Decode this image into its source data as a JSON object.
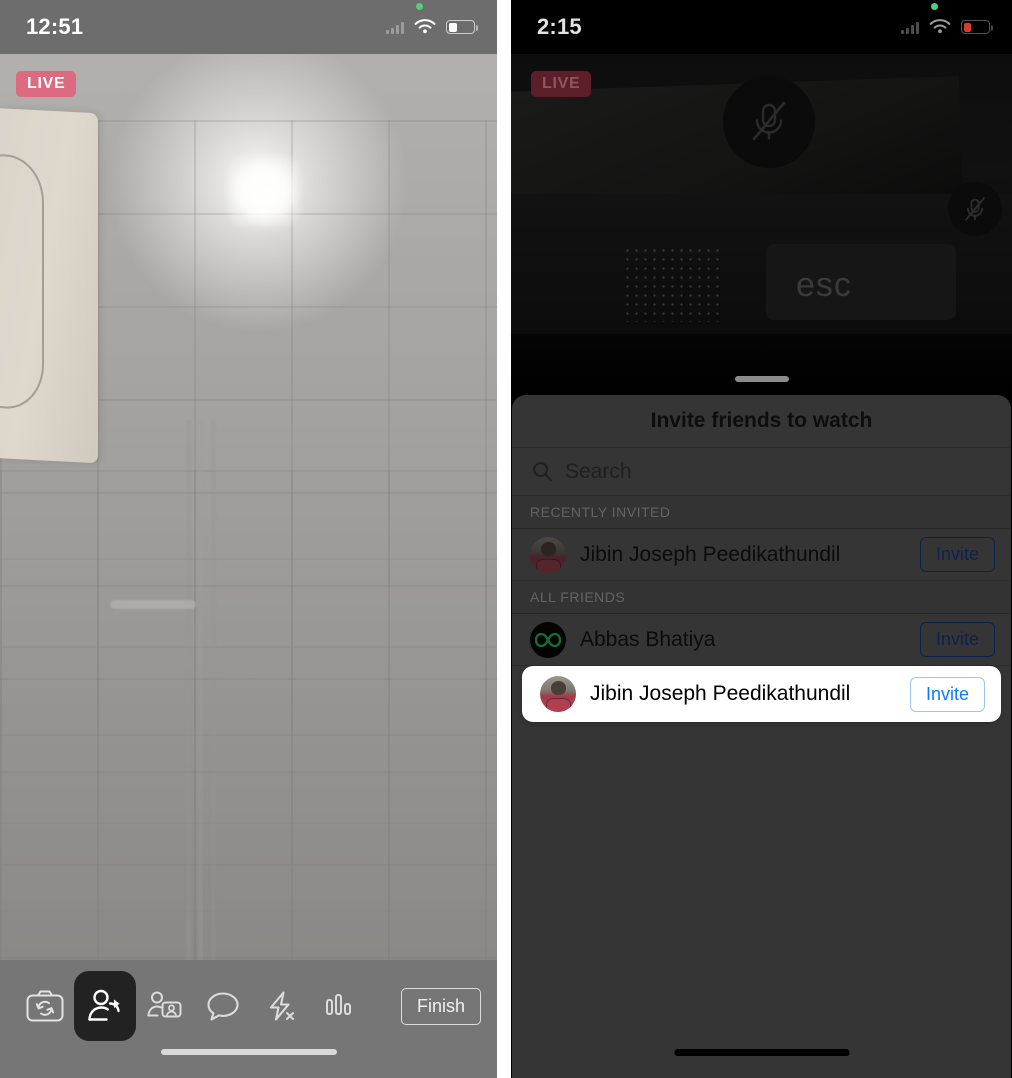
{
  "left_phone": {
    "status_bar": {
      "time": "12:51",
      "wifi_icon": "wifi-icon",
      "battery_icon": "battery-icon",
      "cellular_icon": "cellular-signal-icon",
      "recording_dot": "green-recording-dot"
    },
    "live_badge": "LIVE",
    "toolbar": {
      "items": [
        {
          "name": "flip-camera-icon",
          "label": "Flip Camera",
          "active": false
        },
        {
          "name": "share-person-icon",
          "label": "Invite Friends",
          "active": true
        },
        {
          "name": "person-video-icon",
          "label": "Participants",
          "active": false
        },
        {
          "name": "chat-bubble-icon",
          "label": "Comments",
          "active": false
        },
        {
          "name": "flash-off-icon",
          "label": "Flash Off",
          "active": false
        },
        {
          "name": "stats-bars-icon",
          "label": "Stats",
          "active": false
        }
      ],
      "finish_label": "Finish"
    }
  },
  "right_phone": {
    "status_bar": {
      "time": "2:15",
      "wifi_icon": "wifi-icon",
      "battery_icon": "battery-low-icon",
      "cellular_icon": "cellular-signal-icon",
      "recording_dot": "green-recording-dot"
    },
    "live_badge": "LIVE",
    "video": {
      "key_label": "esc",
      "mute_icon_large": "microphone-muted-icon",
      "mute_icon_small": "microphone-muted-icon"
    },
    "sheet": {
      "grabber": "sheet-grabber",
      "title": "Invite friends to watch",
      "search": {
        "placeholder": "Search",
        "icon": "search-icon",
        "value": ""
      },
      "sections": [
        {
          "header": "RECENTLY INVITED",
          "rows": [
            {
              "name": "Jibin Joseph Peedikathundil",
              "avatar": "person-photo-avatar",
              "action": "Invite"
            }
          ]
        },
        {
          "header": "ALL FRIENDS",
          "rows": [
            {
              "name": "Abbas Bhatiya",
              "avatar": "infinity-logo-avatar",
              "action": "Invite"
            },
            {
              "name": "Jibin Joseph Peedikathundil",
              "avatar": "person-photo-avatar",
              "action": "Invite",
              "highlighted": true
            }
          ]
        }
      ]
    }
  },
  "colors": {
    "live_badge_left": "#dc6a80",
    "live_badge_right": "#5c1f29",
    "sheet_bg": "#4d4d4d",
    "invite_blue_active": "#0a7cff",
    "invite_blue_dim": "#16306f",
    "highlight_card": "#ffffff",
    "toolbar_bg": "#767676",
    "active_tool_bg": "#222222",
    "battery_low_red": "#d83a2e"
  }
}
